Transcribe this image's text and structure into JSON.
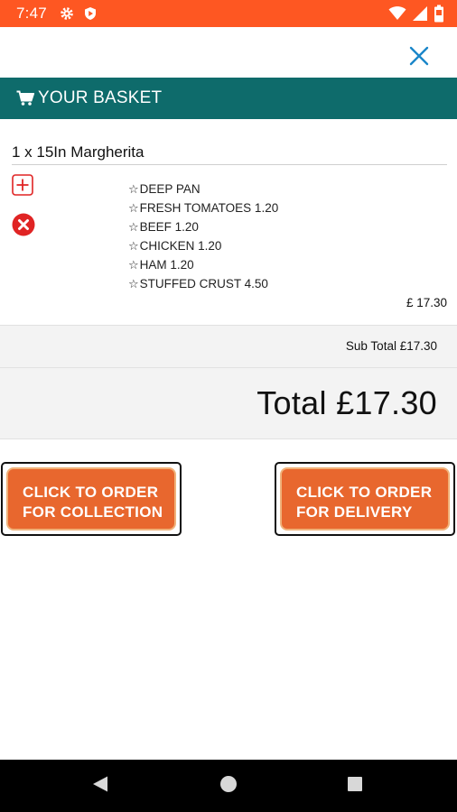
{
  "status_bar": {
    "time": "7:47",
    "icons": [
      "gear-icon",
      "shield-icon",
      "wifi-icon",
      "signal-icon",
      "battery-icon"
    ],
    "color": "#fe5722"
  },
  "header": {
    "close_icon": "close-icon",
    "basket_title": "YOUR BASKET",
    "cart_icon": "cart-icon",
    "color": "#0e6b6b"
  },
  "basket": {
    "items": [
      {
        "name": "1 x 15In Margherita",
        "toppings": [
          "DEEP PAN",
          "FRESH TOMATOES 1.20",
          "BEEF 1.20",
          "CHICKEN 1.20",
          "HAM 1.20",
          "STUFFED CRUST 4.50"
        ],
        "price": "£ 17.30"
      }
    ]
  },
  "totals": {
    "subtotal": "Sub Total £17.30",
    "total": "Total £17.30"
  },
  "buttons": {
    "collection": [
      "CLICK TO ORDER",
      "FOR COLLECTION"
    ],
    "delivery": [
      "CLICK TO ORDER",
      "FOR DELIVERY"
    ],
    "color": "#e8672e"
  },
  "nav": {
    "icons": [
      "back-icon",
      "home-icon",
      "recents-icon"
    ]
  }
}
